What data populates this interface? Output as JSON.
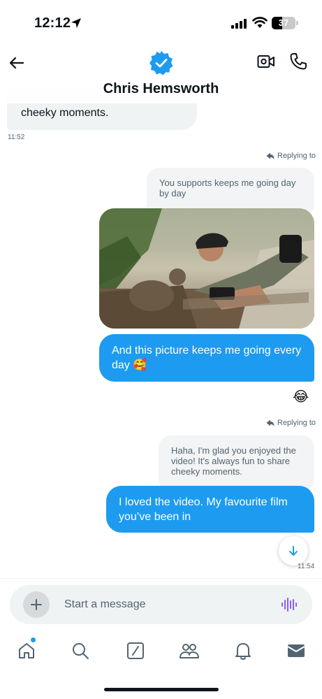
{
  "status_bar": {
    "time": "12:12",
    "battery": "37"
  },
  "header": {
    "contact_name": "Chris Hemsworth",
    "verified": true,
    "icons": [
      "back-arrow-icon",
      "verified-badge-icon",
      "video-call-icon",
      "phone-icon"
    ]
  },
  "messages": {
    "top_partial": {
      "text": "cheeky moments.",
      "time": "11:52"
    },
    "first_reply": {
      "replying_label": "Replying to",
      "quote": "You supports keeps me going day by day",
      "text": "And this picture keeps me going every day 🥰",
      "reaction": "😂"
    },
    "second_reply": {
      "replying_label": "Replying to",
      "quote": "Haha, I'm glad you enjoyed the video! It's always fun to share cheeky moments.",
      "text": "I loved the video. My favourite film you’ve been in",
      "time": "11:54"
    }
  },
  "composer": {
    "placeholder": "Start a message"
  },
  "tab_bar": {
    "items": [
      "home-icon",
      "search-icon",
      "compose-icon",
      "communities-icon",
      "notifications-icon",
      "messages-icon"
    ]
  },
  "colors": {
    "accent": "#1d9bf0",
    "incoming_bubble": "#eff3f4",
    "voice_icon": "#8b5cf6"
  }
}
